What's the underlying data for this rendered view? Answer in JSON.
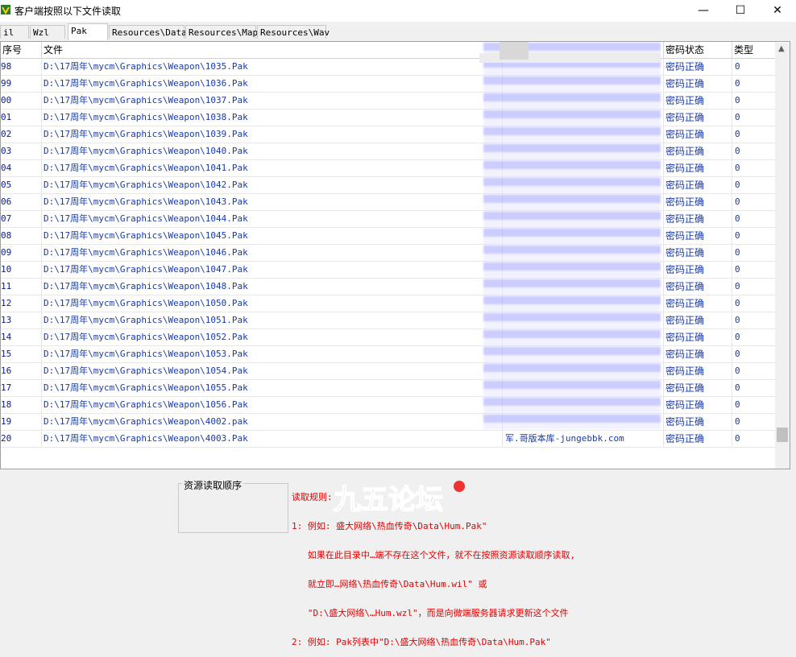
{
  "window": {
    "title": "客户端按照以下文件读取",
    "minimize": "—",
    "maximize": "☐",
    "close": "✕"
  },
  "tabs": [
    {
      "label": "il",
      "active": false
    },
    {
      "label": "Wzl",
      "active": false
    },
    {
      "label": "Pak",
      "active": true
    },
    {
      "label": "Resources\\Data",
      "active": false
    },
    {
      "label": "Resources\\Map",
      "active": false
    },
    {
      "label": "Resources\\Wav",
      "active": false
    }
  ],
  "table": {
    "headers": {
      "num": "序号",
      "file": "文件",
      "status": "密码状态",
      "type": "类型"
    },
    "rows": [
      {
        "num": "98",
        "file": "D:\\17周年\\mycm\\Graphics\\Weapon\\1035.Pak",
        "src": "",
        "status": "密码正确",
        "type": "0"
      },
      {
        "num": "99",
        "file": "D:\\17周年\\mycm\\Graphics\\Weapon\\1036.Pak",
        "src": "",
        "status": "密码正确",
        "type": "0"
      },
      {
        "num": "00",
        "file": "D:\\17周年\\mycm\\Graphics\\Weapon\\1037.Pak",
        "src": "",
        "status": "密码正确",
        "type": "0"
      },
      {
        "num": "01",
        "file": "D:\\17周年\\mycm\\Graphics\\Weapon\\1038.Pak",
        "src": "",
        "status": "密码正确",
        "type": "0"
      },
      {
        "num": "02",
        "file": "D:\\17周年\\mycm\\Graphics\\Weapon\\1039.Pak",
        "src": "",
        "status": "密码正确",
        "type": "0"
      },
      {
        "num": "03",
        "file": "D:\\17周年\\mycm\\Graphics\\Weapon\\1040.Pak",
        "src": "",
        "status": "密码正确",
        "type": "0"
      },
      {
        "num": "04",
        "file": "D:\\17周年\\mycm\\Graphics\\Weapon\\1041.Pak",
        "src": "",
        "status": "密码正确",
        "type": "0"
      },
      {
        "num": "05",
        "file": "D:\\17周年\\mycm\\Graphics\\Weapon\\1042.Pak",
        "src": "",
        "status": "密码正确",
        "type": "0"
      },
      {
        "num": "06",
        "file": "D:\\17周年\\mycm\\Graphics\\Weapon\\1043.Pak",
        "src": "",
        "status": "密码正确",
        "type": "0"
      },
      {
        "num": "07",
        "file": "D:\\17周年\\mycm\\Graphics\\Weapon\\1044.Pak",
        "src": "",
        "status": "密码正确",
        "type": "0"
      },
      {
        "num": "08",
        "file": "D:\\17周年\\mycm\\Graphics\\Weapon\\1045.Pak",
        "src": "",
        "status": "密码正确",
        "type": "0"
      },
      {
        "num": "09",
        "file": "D:\\17周年\\mycm\\Graphics\\Weapon\\1046.Pak",
        "src": "",
        "status": "密码正确",
        "type": "0"
      },
      {
        "num": "10",
        "file": "D:\\17周年\\mycm\\Graphics\\Weapon\\1047.Pak",
        "src": "",
        "status": "密码正确",
        "type": "0"
      },
      {
        "num": "11",
        "file": "D:\\17周年\\mycm\\Graphics\\Weapon\\1048.Pak",
        "src": "",
        "status": "密码正确",
        "type": "0"
      },
      {
        "num": "12",
        "file": "D:\\17周年\\mycm\\Graphics\\Weapon\\1050.Pak",
        "src": "",
        "status": "密码正确",
        "type": "0"
      },
      {
        "num": "13",
        "file": "D:\\17周年\\mycm\\Graphics\\Weapon\\1051.Pak",
        "src": "",
        "status": "密码正确",
        "type": "0"
      },
      {
        "num": "14",
        "file": "D:\\17周年\\mycm\\Graphics\\Weapon\\1052.Pak",
        "src": "",
        "status": "密码正确",
        "type": "0"
      },
      {
        "num": "15",
        "file": "D:\\17周年\\mycm\\Graphics\\Weapon\\1053.Pak",
        "src": "",
        "status": "密码正确",
        "type": "0"
      },
      {
        "num": "16",
        "file": "D:\\17周年\\mycm\\Graphics\\Weapon\\1054.Pak",
        "src": "",
        "status": "密码正确",
        "type": "0"
      },
      {
        "num": "17",
        "file": "D:\\17周年\\mycm\\Graphics\\Weapon\\1055.Pak",
        "src": "",
        "status": "密码正确",
        "type": "0"
      },
      {
        "num": "18",
        "file": "D:\\17周年\\mycm\\Graphics\\Weapon\\1056.Pak",
        "src": "",
        "status": "密码正确",
        "type": "0"
      },
      {
        "num": "19",
        "file": "D:\\17周年\\mycm\\Graphics\\Weapon\\4002.pak",
        "src": "",
        "status": "密码正确",
        "type": "0"
      },
      {
        "num": "20",
        "file": "D:\\17周年\\mycm\\Graphics\\Weapon\\4003.Pak",
        "src": "军.哥版本库-jungebbk.com",
        "status": "密码正确",
        "type": "0"
      }
    ]
  },
  "resource_order": {
    "title": "资源读取顺序"
  },
  "rules": {
    "lines": [
      "读取规则:",
      "1: 例如: 盛大网络\\热血传奇\\Data\\Hum.Pak\"",
      "   如果在此目录中…端不存在这个文件，就不在按照资源读取顺序读取,",
      "   就立即…网络\\热血传奇\\Data\\Hum.wil\" 或",
      "   \"D:\\盛大网络\\…Hum.wzl\"，而是向微端服务器请求更新这个文件",
      "2: 例如: Pak列表中\"D:\\盛大网络\\热血传奇\\Data\\Hum.Pak\""
    ]
  },
  "watermark": {
    "brand": "九五论坛"
  }
}
